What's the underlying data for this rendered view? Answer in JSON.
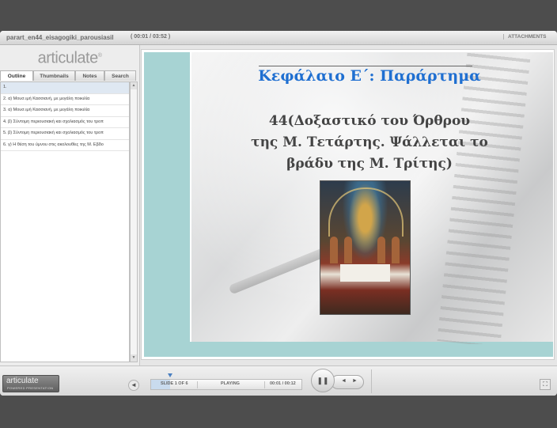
{
  "header": {
    "title": "parart_en44_eisagogiki_parousiasil",
    "duration": "( 00:01 / 03:52 )",
    "attachments_label": "ATTACHMENTS"
  },
  "sidebar": {
    "logo_text": "articulate",
    "tabs": [
      {
        "label": "Outline"
      },
      {
        "label": "Thumbnails"
      },
      {
        "label": "Notes"
      },
      {
        "label": "Search"
      }
    ],
    "outline": [
      "1.",
      "2. α) Μουσ.ιμή Κασσιανή, με μεγάλη ποικιλία",
      "3. α) Μουσ.ιμή Κασσιανή, με μεγάλη ποικιλία",
      "4. β) Σύντομη περιουσιακή και σχολιασμός του τροπ",
      "5. β) Σύντομη περιουσιακή και σχολιασμός του τροπ",
      "6. γ) Η θέση του ύμνου στις ακολουθίες της Μ. Εβδο"
    ]
  },
  "slide": {
    "heading": "Κεφάλαιο Ε΄: Παράρτημα",
    "body_line1": "44(Δοξαστικό του Όρθρου",
    "body_line2": "της Μ. Τετάρτης. Ψάλλεται το",
    "body_line3": "βράδυ της Μ. Τρίτης)"
  },
  "controls": {
    "logo_line1": "articulate",
    "logo_line2": "POWERED PRESENTATION",
    "slide_counter": "SLIDE 1 OF 6",
    "status": "PLAYING",
    "time": "00:01 / 00:12",
    "progress_fraction": 0.125
  },
  "colors": {
    "heading": "#1f6fd1",
    "slide_bg": "#a7d3d3"
  }
}
